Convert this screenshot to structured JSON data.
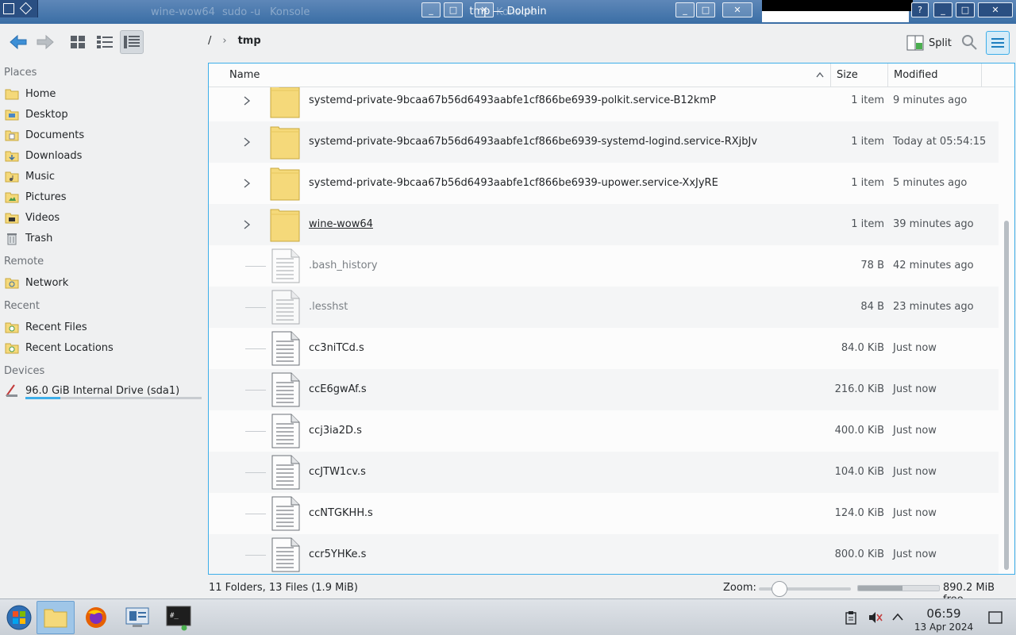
{
  "window": {
    "title": "tmp — Dolphin",
    "ghost_titles": [
      "wine-wow64",
      "sudo -u",
      "Konsole",
      "Konsole"
    ]
  },
  "toolbar": {
    "split_label": "Split",
    "breadcrumb": {
      "root": "/",
      "current": "tmp"
    }
  },
  "sidebar": {
    "places_heading": "Places",
    "places": [
      {
        "label": "Home",
        "icon": "home-folder-icon"
      },
      {
        "label": "Desktop",
        "icon": "desktop-folder-icon"
      },
      {
        "label": "Documents",
        "icon": "documents-folder-icon"
      },
      {
        "label": "Downloads",
        "icon": "downloads-folder-icon"
      },
      {
        "label": "Music",
        "icon": "music-folder-icon"
      },
      {
        "label": "Pictures",
        "icon": "pictures-folder-icon"
      },
      {
        "label": "Videos",
        "icon": "videos-folder-icon"
      },
      {
        "label": "Trash",
        "icon": "trash-icon"
      }
    ],
    "remote_heading": "Remote",
    "remote": [
      {
        "label": "Network",
        "icon": "network-folder-icon"
      }
    ],
    "recent_heading": "Recent",
    "recent": [
      {
        "label": "Recent Files",
        "icon": "recent-files-icon"
      },
      {
        "label": "Recent Locations",
        "icon": "recent-locations-icon"
      }
    ],
    "devices_heading": "Devices",
    "devices": [
      {
        "label": "96.0 GiB Internal Drive (sda1)",
        "icon": "drive-icon",
        "used_fraction": 0.2
      }
    ]
  },
  "columns": {
    "name": "Name",
    "size": "Size",
    "modified": "Modified"
  },
  "files": [
    {
      "name": "systemd-private-9bcaa67b56d6493aabfe1cf866be6939-polkit.service-B12kmP",
      "size": "1 item",
      "modified": "9 minutes ago",
      "type": "folder"
    },
    {
      "name": "systemd-private-9bcaa67b56d6493aabfe1cf866be6939-systemd-logind.service-RXjbJv",
      "size": "1 item",
      "modified": "Today at 05:54:15",
      "type": "folder"
    },
    {
      "name": "systemd-private-9bcaa67b56d6493aabfe1cf866be6939-upower.service-XxJyRE",
      "size": "1 item",
      "modified": "5 minutes ago",
      "type": "folder"
    },
    {
      "name": "wine-wow64",
      "size": "1 item",
      "modified": "39 minutes ago",
      "type": "folder"
    },
    {
      "name": ".bash_history",
      "size": "78 B",
      "modified": "42 minutes ago",
      "type": "hidden-file"
    },
    {
      "name": ".lesshst",
      "size": "84 B",
      "modified": "23 minutes ago",
      "type": "hidden-file"
    },
    {
      "name": "cc3niTCd.s",
      "size": "84.0 KiB",
      "modified": "Just now",
      "type": "file"
    },
    {
      "name": "ccE6gwAf.s",
      "size": "216.0 KiB",
      "modified": "Just now",
      "type": "file"
    },
    {
      "name": "ccj3ia2D.s",
      "size": "400.0 KiB",
      "modified": "Just now",
      "type": "file"
    },
    {
      "name": "ccJTW1cv.s",
      "size": "104.0 KiB",
      "modified": "Just now",
      "type": "file"
    },
    {
      "name": "ccNTGKHH.s",
      "size": "124.0 KiB",
      "modified": "Just now",
      "type": "file"
    },
    {
      "name": "ccr5YHKe.s",
      "size": "800.0 KiB",
      "modified": "Just now",
      "type": "file"
    }
  ],
  "status": {
    "summary": "11 Folders, 13 Files (1.9 MiB)",
    "zoom_label": "Zoom:",
    "free_space": "890.2 MiB free",
    "used_fraction": 0.55
  },
  "taskbar": {
    "clock_time": "06:59",
    "clock_date": "13 Apr 2024"
  },
  "colors": {
    "accent": "#3daee9",
    "folder": "#f5d97a"
  }
}
